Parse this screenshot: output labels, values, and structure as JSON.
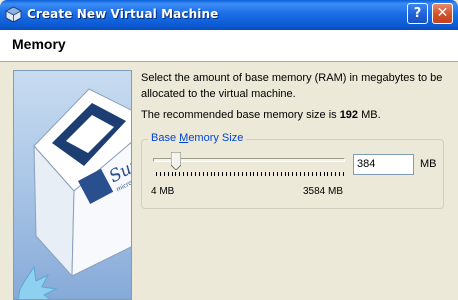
{
  "window": {
    "title": "Create New Virtual Machine",
    "help_label": "?",
    "close_label": "✕"
  },
  "page": {
    "title": "Memory"
  },
  "content": {
    "description": "Select the amount of base memory (RAM) in megabytes to be allocated to the virtual machine.",
    "recommend_prefix": "The recommended base memory size is ",
    "recommend_value": "192",
    "recommend_unit": " MB."
  },
  "memory": {
    "group_label_prefix": "Base ",
    "group_label_accel": "M",
    "group_label_suffix": "emory Size",
    "value": "384",
    "unit": "MB",
    "min_label": "4 MB",
    "max_label": "3584 MB",
    "min": 4,
    "max": 3584,
    "current": 384
  },
  "image": {
    "brand_text": "Sun",
    "brand_sub": "microsystems"
  }
}
